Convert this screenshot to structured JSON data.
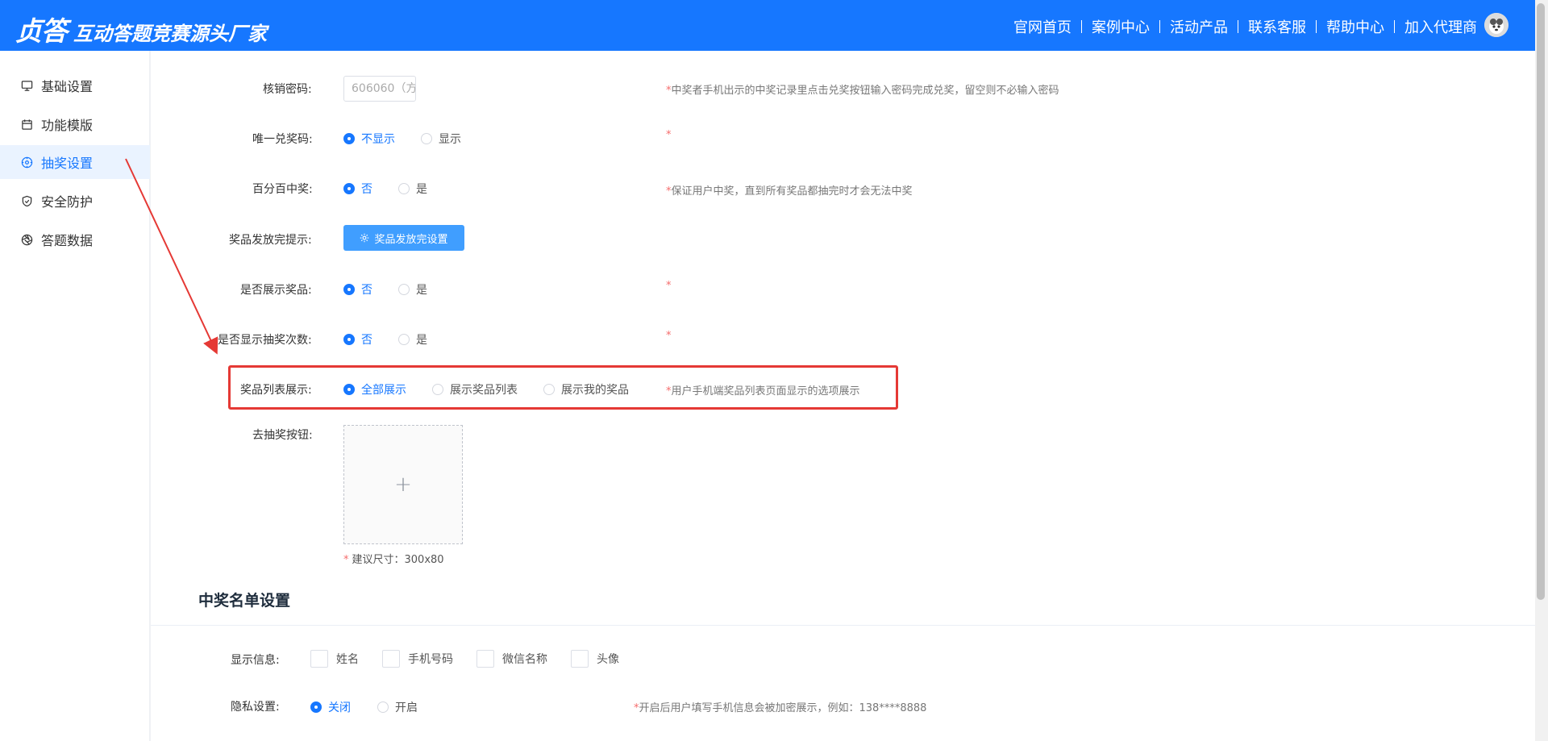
{
  "header": {
    "logo_main": "贞答",
    "logo_sub": "互动答题竞赛源头厂家",
    "nav": [
      "官网首页",
      "案例中心",
      "活动产品",
      "联系客服",
      "帮助中心",
      "加入代理商"
    ]
  },
  "sidebar": {
    "items": [
      {
        "label": "基础设置",
        "icon": "monitor-icon"
      },
      {
        "label": "功能模版",
        "icon": "calendar-icon"
      },
      {
        "label": "抽奖设置",
        "icon": "compass-icon"
      },
      {
        "label": "安全防护",
        "icon": "shield-icon"
      },
      {
        "label": "答题数据",
        "icon": "aperture-icon"
      }
    ],
    "active_index": 2
  },
  "form": {
    "verify_password": {
      "label": "核销密码:",
      "value": "606060（方",
      "tip": "中奖者手机出示的中奖记录里点击兑奖按钮输入密码完成兑奖，留空则不必输入密码"
    },
    "unique_code": {
      "label": "唯一兑奖码:",
      "options": [
        "不显示",
        "显示"
      ],
      "selected": 0,
      "tip": ""
    },
    "guaranteed_win": {
      "label": "百分百中奖:",
      "options": [
        "否",
        "是"
      ],
      "selected": 0,
      "tip": "保证用户中奖，直到所有奖品都抽完时才会无法中奖"
    },
    "prize_done": {
      "label": "奖品发放完提示:",
      "button": "奖品发放完设置"
    },
    "show_prizes": {
      "label": "是否展示奖品:",
      "options": [
        "否",
        "是"
      ],
      "selected": 0,
      "tip": ""
    },
    "show_draw_count": {
      "label": "是否显示抽奖次数:",
      "options": [
        "否",
        "是"
      ],
      "selected": 0,
      "tip": ""
    },
    "prize_list_display": {
      "label": "奖品列表展示:",
      "options": [
        "全部展示",
        "展示奖品列表",
        "展示我的奖品"
      ],
      "selected": 0,
      "tip": "用户手机端奖品列表页面显示的选项展示"
    },
    "draw_button": {
      "label": "去抽奖按钮:",
      "hint": "建议尺寸：300x80"
    }
  },
  "winners_section": {
    "title": "中奖名单设置",
    "display_info": {
      "label": "显示信息:",
      "options": [
        "姓名",
        "手机号码",
        "微信名称",
        "头像"
      ]
    },
    "privacy": {
      "label": "隐私设置:",
      "options": [
        "关闭",
        "开启"
      ],
      "selected": 0,
      "tip": "开启后用户填写手机信息会被加密展示，例如：138****8888"
    }
  },
  "colors": {
    "primary": "#1677ff",
    "button": "#409eff",
    "required_star": "#f56c6c",
    "annotation": "#e53935"
  }
}
